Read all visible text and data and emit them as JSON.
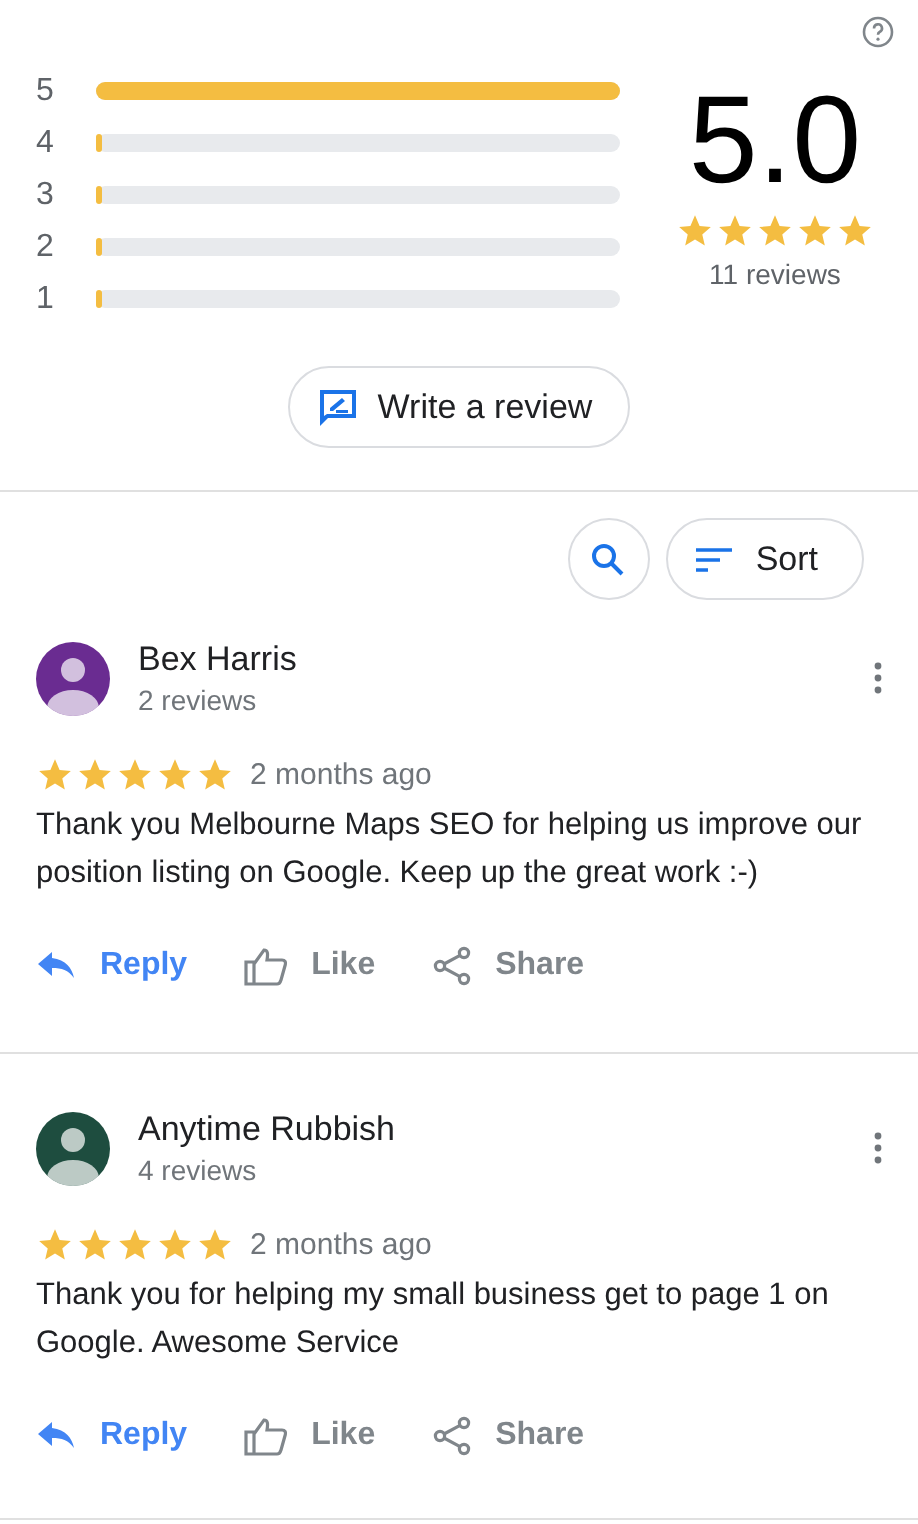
{
  "summary": {
    "distribution": [
      {
        "label": "5",
        "level": 1
      },
      {
        "label": "4",
        "level": 0
      },
      {
        "label": "3",
        "level": 0
      },
      {
        "label": "2",
        "level": 0
      },
      {
        "label": "1",
        "level": 0
      }
    ],
    "score": "5.0",
    "stars": 5,
    "count": "11 reviews",
    "write_button": "Write a review"
  },
  "toolbar": {
    "sort_button": "Sort"
  },
  "reviews": [
    {
      "name": "Bex Harris",
      "color": "#6a2c91",
      "meta": "2 reviews",
      "stars": 5,
      "time": "2 months ago",
      "text": "Thank you Melbourne Maps SEO for helping us improve our position listing on Google.  Keep up the great work :-)",
      "actions": [
        "Reply",
        "Like",
        "Share"
      ]
    },
    {
      "name": "Anytime Rubbish",
      "color": "#1e4d3f",
      "meta": "4 reviews",
      "stars": 5,
      "time": "2 months ago",
      "text": "Thank you for helping my small business get to page 1 on Google. Awesome Service",
      "actions": [
        "Reply",
        "Like",
        "Share"
      ]
    }
  ]
}
